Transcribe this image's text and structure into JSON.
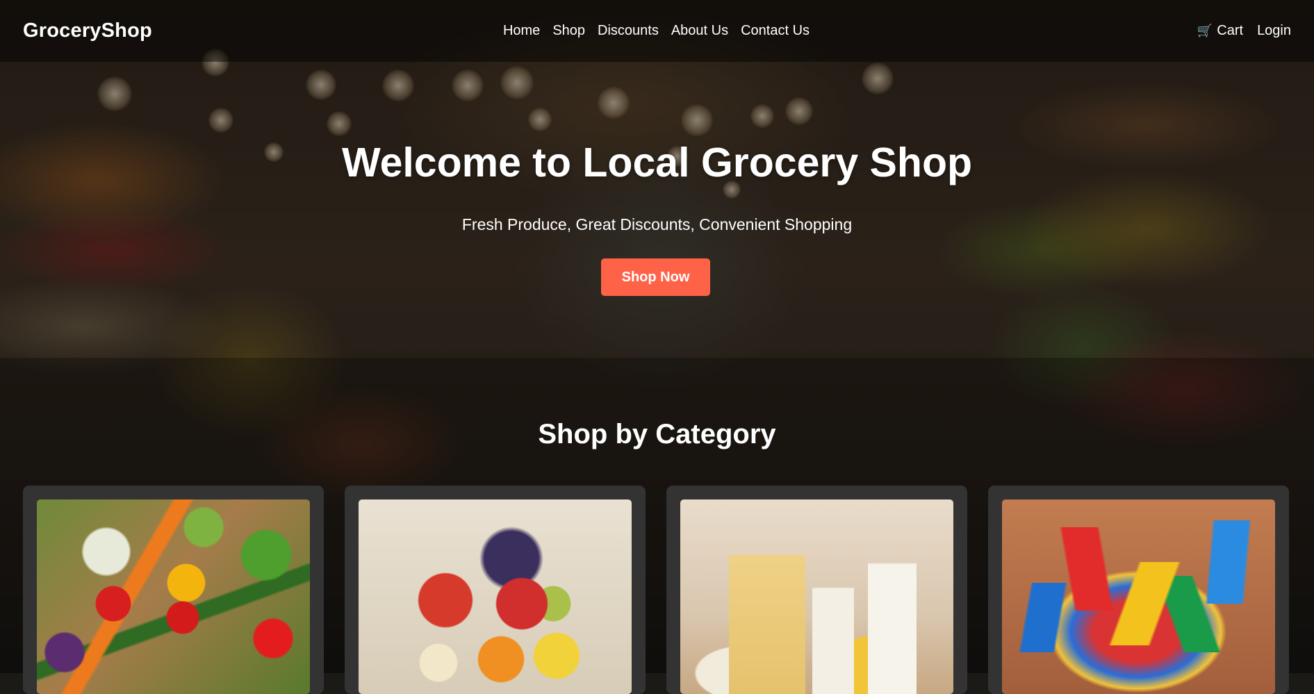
{
  "header": {
    "logo": "GroceryShop",
    "nav": [
      "Home",
      "Shop",
      "Discounts",
      "About Us",
      "Contact Us"
    ],
    "cart_label": "Cart",
    "cart_icon": "shopping-cart-icon",
    "login_label": "Login"
  },
  "hero": {
    "title": "Welcome to Local Grocery Shop",
    "subtitle": "Fresh Produce, Great Discounts, Convenient Shopping",
    "cta_label": "Shop Now"
  },
  "categories": {
    "title": "Shop by Category"
  },
  "colors": {
    "accent": "#ff6347",
    "card_bg": "#333333"
  }
}
